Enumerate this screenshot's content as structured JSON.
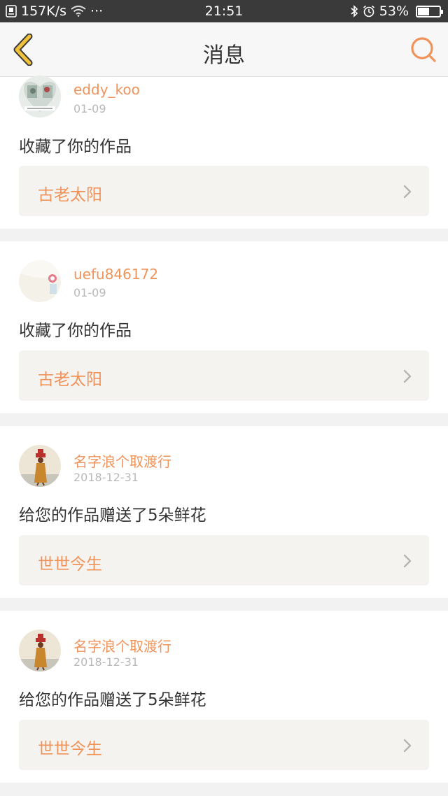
{
  "status_bar": {
    "network_speed": "157K/s",
    "more": "···",
    "time": "21:51",
    "battery": "53%",
    "battery_level": 0.53
  },
  "header": {
    "title": "消息",
    "back_icon": "chevron-left-icon",
    "search_icon": "search-icon"
  },
  "messages": [
    {
      "username": "eddy_koo",
      "date": "01-09",
      "action": "收藏了你的作品",
      "work_title": "古老太阳",
      "avatar": "avatar-eddy"
    },
    {
      "username": "uefu846172",
      "date": "01-09",
      "action": "收藏了你的作品",
      "work_title": "古老太阳",
      "avatar": "avatar-uefu"
    },
    {
      "username": "名字浪个取渡行",
      "date": "2018-12-31",
      "action": "给您的作品赠送了5朵鲜花",
      "work_title": "世世今生",
      "avatar": "avatar-figure"
    },
    {
      "username": "名字浪个取渡行",
      "date": "2018-12-31",
      "action": "给您的作品赠送了5朵鲜花",
      "work_title": "世世今生",
      "avatar": "avatar-figure"
    }
  ],
  "colors": {
    "accent": "#f0935a",
    "back_icon": "#f3c23b",
    "status_bar_bg": "#3a3a3a"
  }
}
